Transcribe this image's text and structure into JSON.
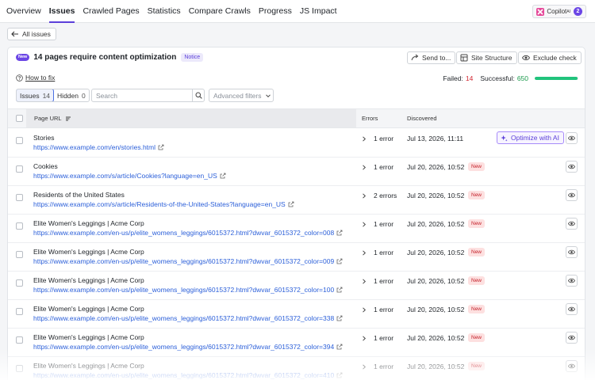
{
  "nav": {
    "tabs": [
      {
        "label": "Overview",
        "active": false
      },
      {
        "label": "Issues",
        "active": true
      },
      {
        "label": "Crawled Pages",
        "active": false
      },
      {
        "label": "Statistics",
        "active": false
      },
      {
        "label": "Compare Crawls",
        "active": false
      },
      {
        "label": "Progress",
        "active": false
      },
      {
        "label": "JS Impact",
        "active": false
      }
    ],
    "copilot": {
      "label": "Copilot",
      "sup": "AI",
      "count": "2"
    }
  },
  "back_label": "All issues",
  "issue": {
    "new_badge": "New",
    "title": "14 pages require content optimization",
    "level": "Notice",
    "actions": {
      "send": "Send to...",
      "structure": "Site Structure",
      "exclude": "Exclude check"
    },
    "how_to_fix": "How to fix",
    "failed_label": "Failed:",
    "failed_count": "14",
    "successful_label": "Successful:",
    "successful_count": "650",
    "success_fraction": 0.979
  },
  "filters": {
    "issues_label": "Issues",
    "issues_count": "14",
    "hidden_label": "Hidden",
    "hidden_count": "0",
    "search_placeholder": "Search",
    "advanced_label": "Advanced filters"
  },
  "table": {
    "headers": {
      "url": "Page URL",
      "errors": "Errors",
      "discovered": "Discovered"
    },
    "optimize_label": "Optimize with AI",
    "new_label": "New",
    "rows": [
      {
        "title": "Stories",
        "url": "https://www.example.com/en/stories.html",
        "errors": "1 error",
        "date": "Jul 13, 2026, 11:11",
        "is_new": false
      },
      {
        "title": "Cookies",
        "url": "https://www.example.com/s/article/Cookies?language=en_US",
        "errors": "1 error",
        "date": "Jul 20, 2026, 10:52",
        "is_new": true
      },
      {
        "title": "Residents of the United States",
        "url": "https://www.example.com/s/article/Residents-of-the-United-States?language=en_US",
        "errors": "2 errors",
        "date": "Jul 20, 2026, 10:52",
        "is_new": true
      },
      {
        "title": "Elite Women's Leggings | Acme Corp",
        "url": "https://www.example.com/en-us/p/elite_womens_leggings/6015372.html?dwvar_6015372_color=008",
        "errors": "1 error",
        "date": "Jul 20, 2026, 10:52",
        "is_new": true
      },
      {
        "title": "Elite Women's Leggings | Acme Corp",
        "url": "https://www.example.com/en-us/p/elite_womens_leggings/6015372.html?dwvar_6015372_color=009",
        "errors": "1 error",
        "date": "Jul 20, 2026, 10:52",
        "is_new": true
      },
      {
        "title": "Elite Women's Leggings | Acme Corp",
        "url": "https://www.example.com/en-us/p/elite_womens_leggings/6015372.html?dwvar_6015372_color=100",
        "errors": "1 error",
        "date": "Jul 20, 2026, 10:52",
        "is_new": true
      },
      {
        "title": "Elite Women's Leggings | Acme Corp",
        "url": "https://www.example.com/en-us/p/elite_womens_leggings/6015372.html?dwvar_6015372_color=338",
        "errors": "1 error",
        "date": "Jul 20, 2026, 10:52",
        "is_new": true
      },
      {
        "title": "Elite Women's Leggings | Acme Corp",
        "url": "https://www.example.com/en-us/p/elite_womens_leggings/6015372.html?dwvar_6015372_color=394",
        "errors": "1 error",
        "date": "Jul 20, 2026, 10:52",
        "is_new": true
      },
      {
        "title": "Elite Women's Leggings | Acme Corp",
        "url": "https://www.example.com/en-us/p/elite_womens_leggings/6015372.html?dwvar_6015372_color=410",
        "errors": "1 error",
        "date": "Jul 20, 2026, 10:52",
        "is_new": true
      }
    ]
  },
  "colors": {
    "accent": "#5b3fd9",
    "link": "#2b5fd9",
    "failed": "#d1242f",
    "success": "#1a9a4b",
    "progress": "#21c37c"
  }
}
